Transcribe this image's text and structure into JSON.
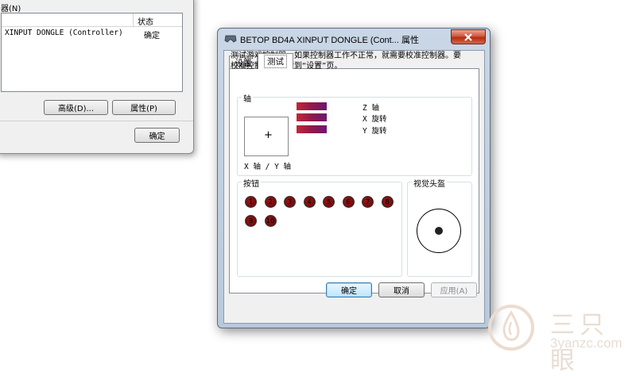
{
  "background_window": {
    "list_label": "器(N)",
    "column_status": "状态",
    "row_name": "XINPUT DONGLE (Controller)",
    "row_status": "确定",
    "advanced_button": "高级(D)...",
    "properties_button": "属性(P)",
    "ok_button": "确定"
  },
  "dialog": {
    "title": "BETOP BD4A XINPUT DONGLE (Cont... 属性",
    "close_icon": "close-icon",
    "tabs": [
      {
        "label": "设置",
        "selected": false
      },
      {
        "label": "测试",
        "selected": true
      }
    ],
    "description": "测试游戏控制器。如果控制器工作不正常，就需要校准控制器。要校准控制器，请转到“设置”页。",
    "axis_group": {
      "label": "轴",
      "xy_label": "X 轴 / Y 轴",
      "crosshair": "+",
      "axes": [
        {
          "name": "Z 轴",
          "color": "#8f1a4a"
        },
        {
          "name": "X 旋转",
          "color": "#8f1a4a"
        },
        {
          "name": "Y 旋转",
          "color": "#8f1a4a"
        }
      ]
    },
    "buttons_group": {
      "label": "按钮",
      "buttons": [
        "1",
        "2",
        "3",
        "4",
        "5",
        "6",
        "7",
        "8",
        "9",
        "10"
      ],
      "button_color": "#9a1414"
    },
    "hat_group": {
      "label": "视觉头盔"
    },
    "ok_button": "确定",
    "cancel_button": "取消",
    "apply_button": "应用(A)"
  },
  "watermark": {
    "brand": "三只眼",
    "url": "3yanzc.com"
  }
}
